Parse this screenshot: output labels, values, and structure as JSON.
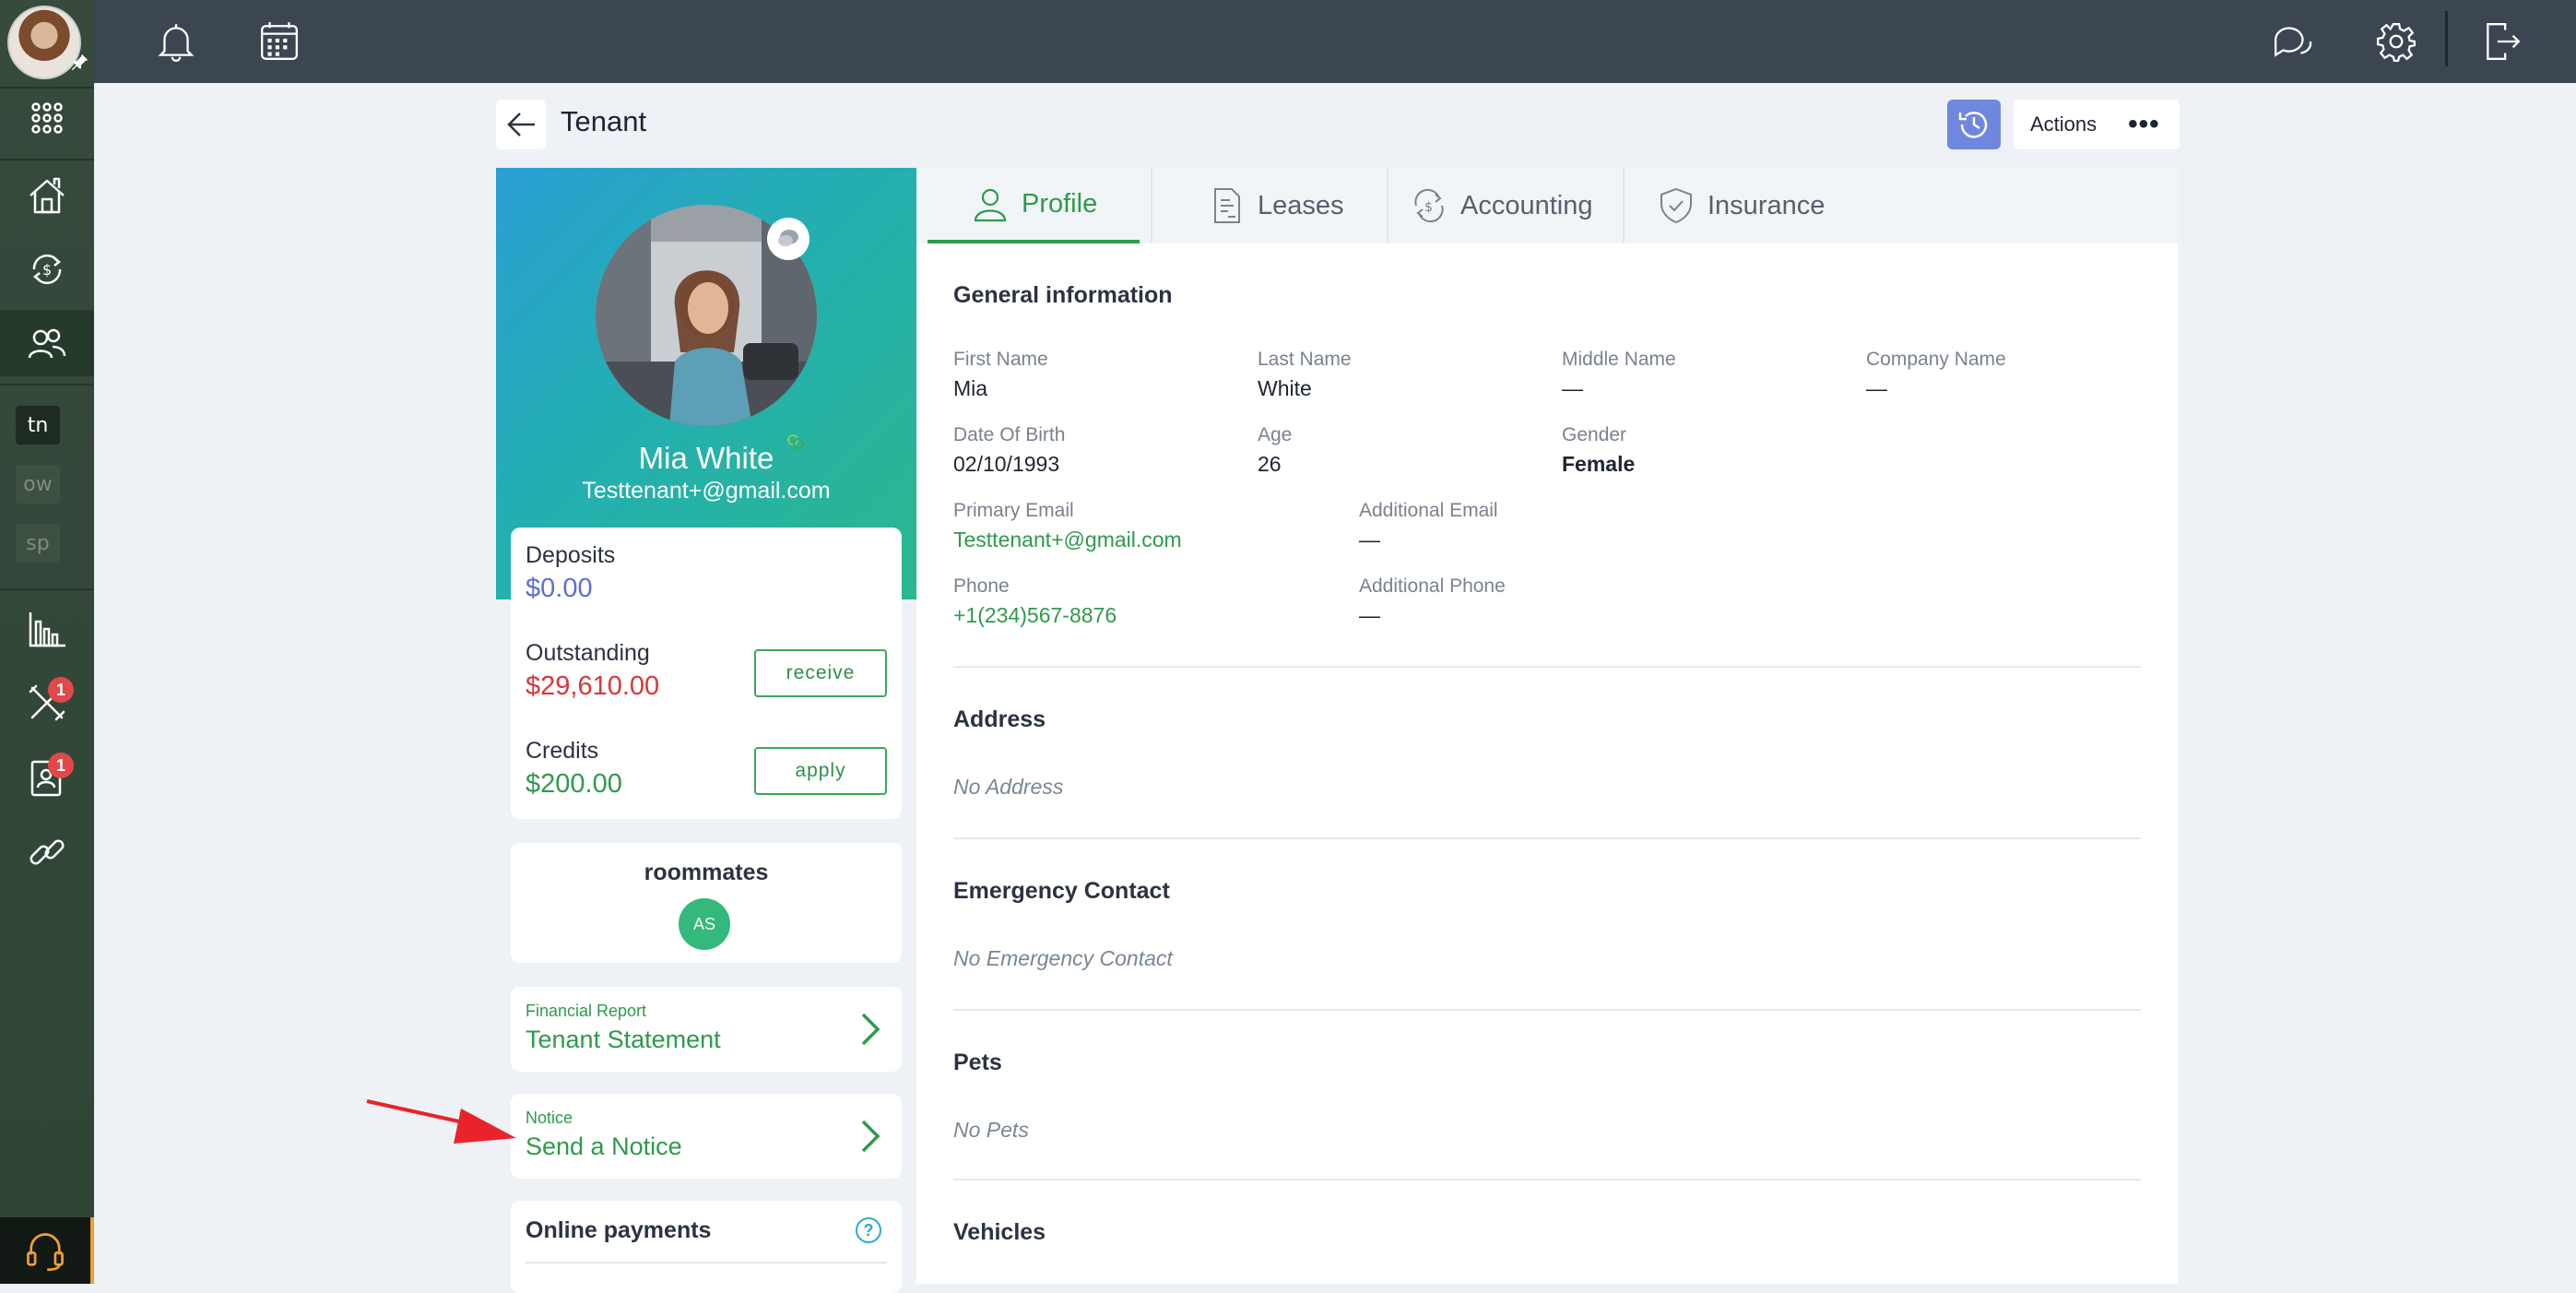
{
  "page": {
    "title": "Tenant"
  },
  "header": {
    "actions_label": "Actions",
    "more_label": "•••"
  },
  "sidebar": {
    "tags": [
      {
        "label": "tn"
      },
      {
        "label": "ow"
      },
      {
        "label": "sp"
      }
    ],
    "maintenance_badge": "1",
    "tenants_badge": "1"
  },
  "tenant": {
    "name": "Mia White",
    "email": "Testtenant+@gmail.com"
  },
  "finance": {
    "deposits_label": "Deposits",
    "deposits_value": "$0.00",
    "outstanding_label": "Outstanding",
    "outstanding_value": "$29,610.00",
    "receive_label": "receive",
    "credits_label": "Credits",
    "credits_value": "$200.00",
    "apply_label": "apply"
  },
  "roommates": {
    "title": "roommates",
    "initials": "AS"
  },
  "links": {
    "statement_small": "Financial Report",
    "statement_big": "Tenant Statement",
    "notice_small": "Notice",
    "notice_big": "Send a Notice"
  },
  "online_payments": {
    "title": "Online payments",
    "help": "?"
  },
  "tabs": [
    {
      "label": "Profile"
    },
    {
      "label": "Leases"
    },
    {
      "label": "Accounting"
    },
    {
      "label": "Insurance"
    }
  ],
  "general": {
    "title": "General information",
    "first_name_label": "First Name",
    "first_name": "Mia",
    "last_name_label": "Last Name",
    "last_name": "White",
    "middle_name_label": "Middle Name",
    "middle_name": "—",
    "company_name_label": "Company Name",
    "company_name": "—",
    "dob_label": "Date Of Birth",
    "dob": "02/10/1993",
    "age_label": "Age",
    "age": "26",
    "gender_label": "Gender",
    "gender": "Female",
    "primary_email_label": "Primary Email",
    "primary_email": "Testtenant+@gmail.com",
    "additional_email_label": "Additional Email",
    "additional_email": "—",
    "phone_label": "Phone",
    "phone": "+1(234)567-8876",
    "additional_phone_label": "Additional Phone",
    "additional_phone": "—"
  },
  "address": {
    "title": "Address",
    "empty": "No Address"
  },
  "emergency": {
    "title": "Emergency Contact",
    "empty": "No Emergency Contact"
  },
  "pets": {
    "title": "Pets",
    "empty": "No Pets"
  },
  "vehicles": {
    "title": "Vehicles"
  },
  "colors": {
    "accent_green": "#2e9a4c",
    "outstanding_red": "#d8373b",
    "deposit_blue": "#5b6fd6",
    "badge_red": "#e34848"
  }
}
